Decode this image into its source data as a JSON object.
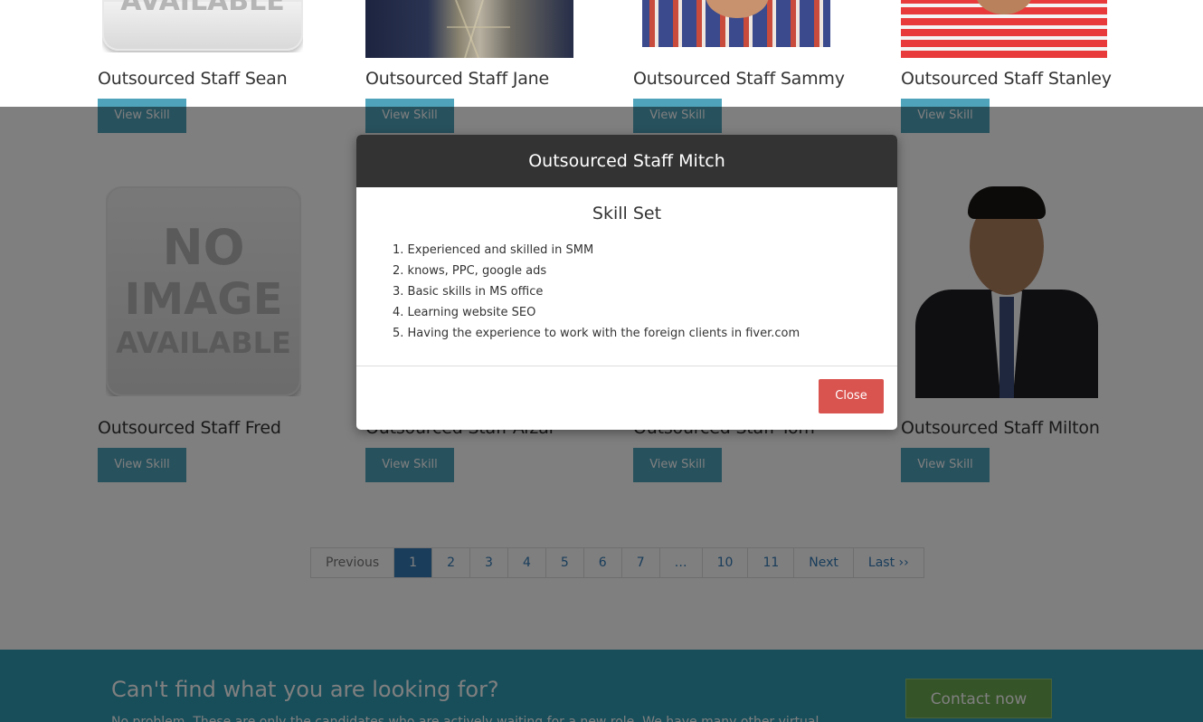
{
  "staff_row1": [
    {
      "name": "Outsourced Staff Sean",
      "button": "View Skill",
      "photo": "no-image"
    },
    {
      "name": "Outsourced Staff Jane",
      "button": "View Skill",
      "photo": "person"
    },
    {
      "name": "Outsourced Staff Sammy",
      "button": "View Skill",
      "photo": "person"
    },
    {
      "name": "Outsourced Staff Stanley",
      "button": "View Skill",
      "photo": "person"
    }
  ],
  "staff_row2": [
    {
      "name": "Outsourced Staff Fred",
      "button": "View Skill",
      "photo": "no-image"
    },
    {
      "name": "Outsourced Staff Afzal",
      "button": "View Skill",
      "photo": "hidden"
    },
    {
      "name": "Outsourced Staff Tom",
      "button": "View Skill",
      "photo": "hidden"
    },
    {
      "name": "Outsourced Staff Milton",
      "button": "View Skill",
      "photo": "person"
    }
  ],
  "no_image": {
    "line1": "NO",
    "line2": "IMAGE",
    "line3": "AVAILABLE",
    "top_partial": "AVAILABLE"
  },
  "pagination": [
    "Previous",
    "1",
    "2",
    "3",
    "4",
    "5",
    "6",
    "7",
    "…",
    "10",
    "11",
    "Next",
    "Last ››"
  ],
  "pagination_active": "1",
  "modal": {
    "title": "Outsourced Staff Mitch",
    "subtitle": "Skill Set",
    "skills": [
      "1. Experienced and skilled in SMM",
      "2. knows, PPC, google ads",
      "3. Basic skills in MS office",
      "4. Learning website SEO",
      "5. Having the experience to work with the foreign clients in fiver.com"
    ],
    "close_label": "Close"
  },
  "footer": {
    "title": "Can't find what you are looking for?",
    "text": "No problem. These are only the candidates who are actively waiting for a new role. We have many other virtual",
    "contact_label": "Contact now"
  },
  "colors": {
    "button": "#4fa3bb",
    "footer": "#2e9cb4",
    "contact": "#6aa84f",
    "close": "#d9534f",
    "modal_header": "#333333"
  }
}
